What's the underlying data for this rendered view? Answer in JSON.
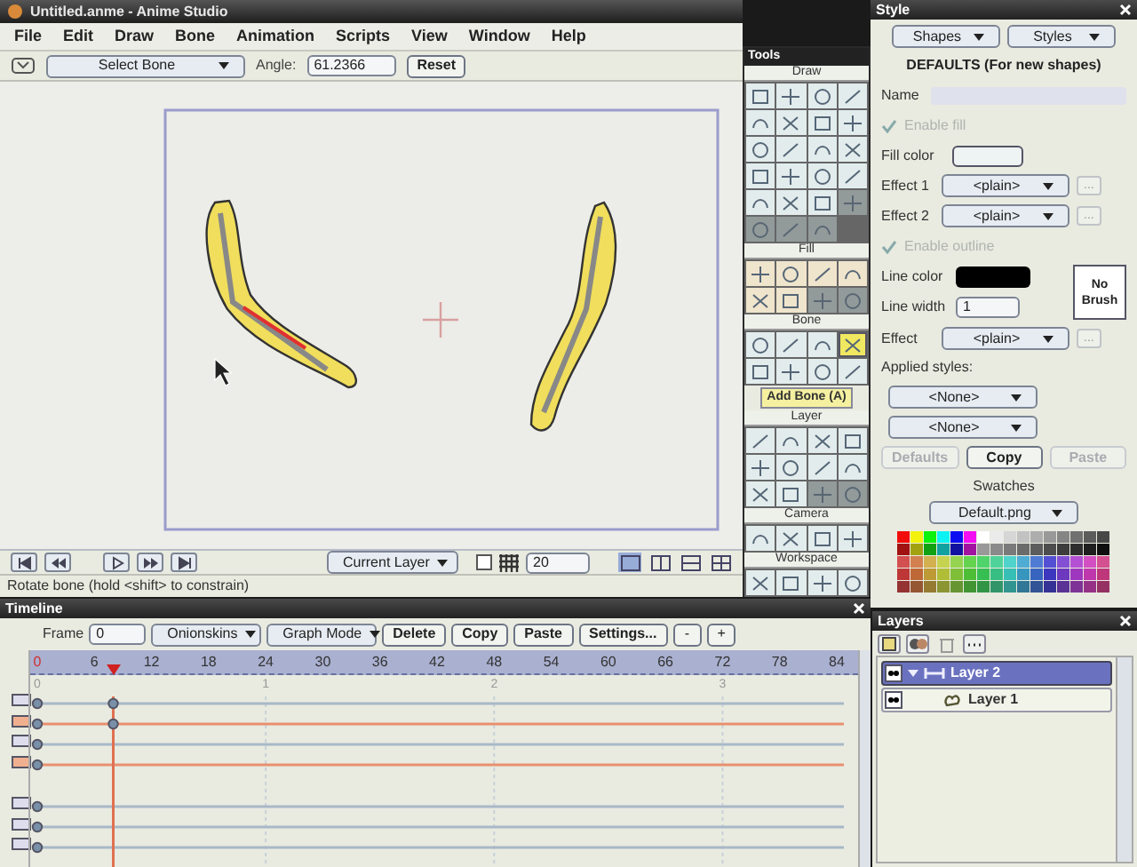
{
  "main_window": {
    "title": "Untitled.anme - Anime Studio",
    "menu": [
      "File",
      "Edit",
      "Draw",
      "Bone",
      "Animation",
      "Scripts",
      "View",
      "Window",
      "Help"
    ],
    "toolbar": {
      "tool_dropdown": "Select Bone",
      "angle_label": "Angle:",
      "angle_value": "61.2366",
      "reset": "Reset"
    },
    "controls": {
      "layer_dropdown": "Current Layer",
      "checkbox_checked": false,
      "grid_value": "20",
      "views": [
        {
          "selected": true
        },
        {
          "selected": false
        },
        {
          "selected": false
        },
        {
          "selected": false
        }
      ]
    },
    "status": "Rotate bone (hold <shift> to constrain)"
  },
  "tools": {
    "title": "Tools",
    "groups": [
      {
        "label": "Draw",
        "buttons": [
          {
            "selected": false,
            "disabled": false
          },
          {
            "selected": false,
            "disabled": false
          },
          {
            "selected": false,
            "disabled": false
          },
          {
            "selected": false,
            "disabled": false
          },
          {
            "selected": false,
            "disabled": false
          },
          {
            "selected": false,
            "disabled": false
          },
          {
            "selected": false,
            "disabled": false
          },
          {
            "selected": false,
            "disabled": false
          },
          {
            "selected": false,
            "disabled": false
          },
          {
            "selected": false,
            "disabled": false
          },
          {
            "selected": false,
            "disabled": false
          },
          {
            "selected": false,
            "disabled": false
          },
          {
            "selected": false,
            "disabled": false
          },
          {
            "selected": false,
            "disabled": false
          },
          {
            "selected": false,
            "disabled": false
          },
          {
            "selected": false,
            "disabled": false
          },
          {
            "selected": false,
            "disabled": false
          },
          {
            "selected": false,
            "disabled": false
          },
          {
            "selected": false,
            "disabled": false
          },
          {
            "selected": false,
            "disabled": true
          },
          {
            "selected": false,
            "disabled": true
          },
          {
            "selected": false,
            "disabled": true
          },
          {
            "selected": false,
            "disabled": true
          }
        ]
      },
      {
        "label": "Fill",
        "buttons": [
          {
            "selected": false,
            "disabled": false
          },
          {
            "selected": false,
            "disabled": false
          },
          {
            "selected": false,
            "disabled": false
          },
          {
            "selected": false,
            "disabled": false
          },
          {
            "selected": false,
            "disabled": false
          },
          {
            "selected": false,
            "disabled": false
          },
          {
            "selected": false,
            "disabled": true
          },
          {
            "selected": false,
            "disabled": true
          }
        ]
      },
      {
        "label": "Bone",
        "hint": "Add Bone (A)",
        "buttons": [
          {
            "selected": false,
            "disabled": false
          },
          {
            "selected": false,
            "disabled": false
          },
          {
            "selected": false,
            "disabled": false
          },
          {
            "selected": true,
            "disabled": false
          },
          {
            "selected": false,
            "disabled": false
          },
          {
            "selected": false,
            "disabled": false
          },
          {
            "selected": false,
            "disabled": false
          },
          {
            "selected": false,
            "disabled": false
          }
        ]
      },
      {
        "label": "Layer",
        "buttons": [
          {
            "selected": false,
            "disabled": false
          },
          {
            "selected": false,
            "disabled": false
          },
          {
            "selected": false,
            "disabled": false
          },
          {
            "selected": false,
            "disabled": false
          },
          {
            "selected": false,
            "disabled": false
          },
          {
            "selected": false,
            "disabled": false
          },
          {
            "selected": false,
            "disabled": false
          },
          {
            "selected": false,
            "disabled": false
          },
          {
            "selected": false,
            "disabled": false
          },
          {
            "selected": false,
            "disabled": false
          },
          {
            "selected": false,
            "disabled": true
          },
          {
            "selected": false,
            "disabled": true
          }
        ]
      },
      {
        "label": "Camera",
        "buttons": [
          {
            "selected": false,
            "disabled": false
          },
          {
            "selected": false,
            "disabled": false
          },
          {
            "selected": false,
            "disabled": false
          },
          {
            "selected": false,
            "disabled": false
          }
        ]
      },
      {
        "label": "Workspace",
        "buttons": [
          {
            "selected": false,
            "disabled": false
          },
          {
            "selected": false,
            "disabled": false
          },
          {
            "selected": false,
            "disabled": false
          },
          {
            "selected": false,
            "disabled": false
          }
        ]
      }
    ]
  },
  "style": {
    "title": "Style",
    "dropdowns": [
      "Shapes",
      "Styles"
    ],
    "heading": "DEFAULTS (For new shapes)",
    "name_label": "Name",
    "enable_fill": {
      "label": "Enable fill",
      "checked": true
    },
    "fill_color_label": "Fill color",
    "fill_effects": [
      {
        "label": "Effect 1",
        "value": "<plain>",
        "more": "..."
      },
      {
        "label": "Effect 2",
        "value": "<plain>",
        "more": "..."
      }
    ],
    "enable_outline": {
      "label": "Enable outline",
      "checked": true
    },
    "line_color_label": "Line color",
    "line_width_label": "Line width",
    "line_width_value": "1",
    "brush_button": "No Brush",
    "outline_effect": {
      "label": "Effect",
      "value": "<plain>",
      "more": "..."
    },
    "applied_label": "Applied styles:",
    "applied": [
      "<None>",
      "<None>"
    ],
    "buttons": [
      {
        "label": "Defaults",
        "disabled": true
      },
      {
        "label": "Copy",
        "disabled": false
      },
      {
        "label": "Paste",
        "disabled": true
      }
    ],
    "swatches_label": "Swatches",
    "swatches_dropdown": "Default.png"
  },
  "timeline": {
    "title": "Timeline",
    "frame_label": "Frame",
    "frame_value": "0",
    "dropdowns": [
      "Onionskins",
      "Graph Mode"
    ],
    "buttons": [
      "Delete",
      "Copy",
      "Paste",
      "Settings...",
      "-",
      "+"
    ],
    "frame_ticks": [
      "0",
      "6",
      "12",
      "18",
      "24",
      "30",
      "36",
      "42",
      "48",
      "54",
      "60",
      "66",
      "72",
      "78",
      "84"
    ],
    "second_ticks": [
      "0",
      "1",
      "2",
      "3"
    ],
    "playhead": {
      "level": 0.095
    },
    "track_groups": [
      [
        {
          "highlighted": false,
          "keys": [
            {
              "level": 0
            },
            {
              "level": 0.095
            }
          ]
        },
        {
          "highlighted": true,
          "keys": [
            {
              "level": 0
            },
            {
              "level": 0.095
            }
          ]
        },
        {
          "highlighted": false,
          "keys": [
            {
              "level": 0
            }
          ]
        },
        {
          "highlighted": true,
          "keys": [
            {
              "level": 0
            }
          ]
        }
      ],
      [
        {
          "highlighted": false,
          "keys": [
            {
              "level": 0
            }
          ]
        },
        {
          "highlighted": false,
          "keys": [
            {
              "level": 0
            }
          ]
        },
        {
          "highlighted": false,
          "keys": [
            {
              "level": 0
            }
          ]
        }
      ]
    ]
  },
  "layers": {
    "title": "Layers",
    "items": [
      {
        "name": "Layer 2",
        "kind": "bone",
        "selected": true,
        "expanded": true,
        "children": [
          {
            "name": "Layer 1",
            "kind": "vector",
            "selected": false
          }
        ]
      }
    ]
  }
}
